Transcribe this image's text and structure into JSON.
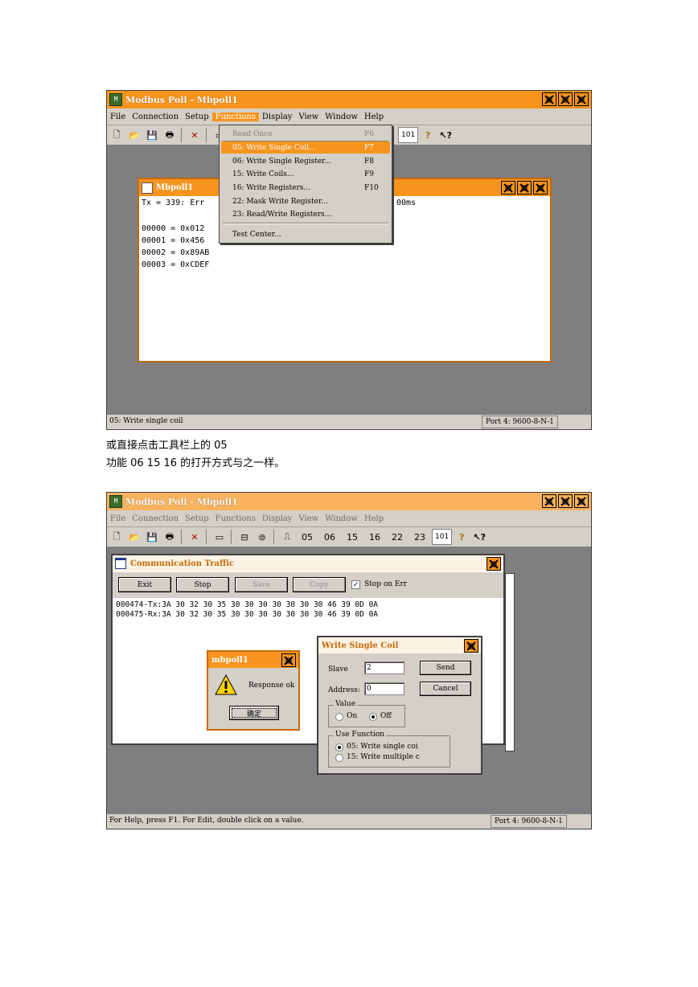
{
  "screen1": {
    "title": "Modbus Poll - Mbpoll1",
    "menu": [
      "File",
      "Connection",
      "Setup",
      "Functions",
      "Display",
      "View",
      "Window",
      "Help"
    ],
    "toolbar_tail": "101",
    "child_title": "Mbpoll1",
    "tx_line_left": "Tx = 339: Err",
    "tx_line_right": "00ms",
    "registers": [
      "00000 = 0x012",
      "00001 = 0x456",
      "00002 = 0x89AB",
      "00003 = 0xCDEF"
    ],
    "dropdown": [
      {
        "label": "Read Once",
        "key": "F6",
        "state": "disabled"
      },
      {
        "label": "05: Write Single Coil...",
        "key": "F7",
        "state": "selected"
      },
      {
        "label": "06: Write Single Register...",
        "key": "F8",
        "state": "normal"
      },
      {
        "label": "15: Write Coils...",
        "key": "F9",
        "state": "normal"
      },
      {
        "label": "16: Write Registers...",
        "key": "F10",
        "state": "normal"
      },
      {
        "label": "22: Mask Write Register...",
        "key": "",
        "state": "normal"
      },
      {
        "label": "23: Read/Write Registers...",
        "key": "",
        "state": "normal"
      },
      {
        "label": "Test Center...",
        "key": "",
        "state": "normal"
      }
    ],
    "status_left": "05: Write single coil",
    "status_right": "Port 4: 9600-8-N-1"
  },
  "caption1": "或直接点击工具栏上的 05",
  "caption2": "功能  06 15 16  的打开方式与之一样。",
  "screen2": {
    "title": "Modbus Poll - Mbpoll1",
    "menu": [
      "File",
      "Connection",
      "Setup",
      "Functions",
      "Display",
      "View",
      "Window",
      "Help"
    ],
    "toolbar_fn": [
      "05",
      "06",
      "15",
      "16",
      "22",
      "23"
    ],
    "toolbar_tail": "101",
    "traffic": {
      "title": "Communication Traffic",
      "buttons": [
        "Exit",
        "Stop",
        "Save",
        "Copy"
      ],
      "stop_on_err": "Stop on Err",
      "lines": [
        "000474-Tx:3A 30 32 30 35 30 30 30 30 30 30 30 46 39 0D 0A",
        "000475-Rx:3A 30 32 30 35 30 30 30 30 30 30 30 46 39 0D 0A"
      ]
    },
    "msgbox": {
      "title": "mbpoll1",
      "text": "Response ok",
      "ok": "确定"
    },
    "wsc": {
      "title": "Write Single Coil",
      "slave_label": "Slave",
      "slave_value": "2",
      "address_label": "Address:",
      "address_value": "0",
      "send": "Send",
      "cancel": "Cancel",
      "value_group": "Value",
      "on": "On",
      "off": "Off",
      "use_group": "Use Function",
      "opt05": "05: Write single coi",
      "opt15": "15: Write multiple c"
    },
    "status_left": "For Help, press F1.  For Edit, double click on a value.",
    "status_right": "Port 4: 9600-8-N-1"
  }
}
